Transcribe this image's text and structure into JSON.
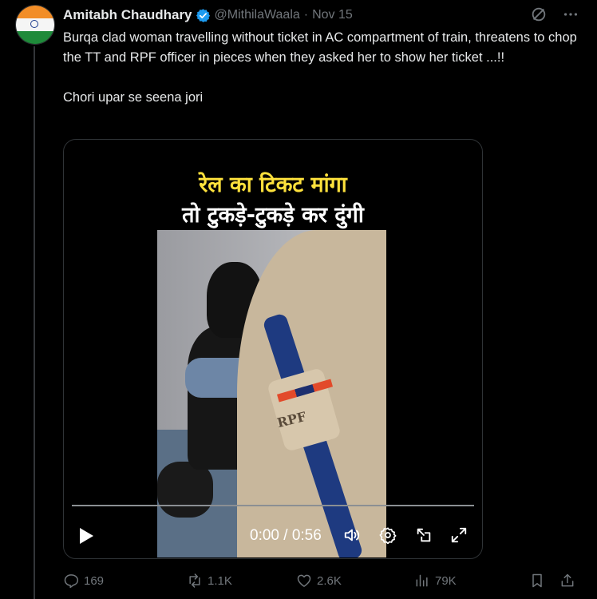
{
  "author": {
    "name": "Amitabh Chaudhary",
    "handle": "@MithilaWaala",
    "separator": "·",
    "date": "Nov 15"
  },
  "tweet": {
    "text": "Burqa clad woman travelling without ticket in AC compartment of train, threatens to chop the TT and RPF officer in pieces when they asked her to show her ticket ...!!\n\nChori upar se seena jori"
  },
  "video": {
    "caption_line1": "रेल का टिकट मांगा",
    "caption_line2": "तो टुकड़े-टुकड़े कर दुंगी",
    "badge_text": "RPF",
    "time_display": "0:00 / 0:56",
    "progress": 0.0
  },
  "actions": {
    "replies": "169",
    "reposts": "1.1K",
    "likes": "2.6K",
    "views": "79K"
  },
  "colors": {
    "background": "#000000",
    "text": "#e7e9ea",
    "muted": "#71767b",
    "verified": "#1d9bf0",
    "caption_yellow": "#fde13c"
  },
  "icons": [
    "grok-icon",
    "more-icon",
    "verified-icon",
    "play-icon",
    "volume-icon",
    "settings-icon",
    "pip-icon",
    "fullscreen-icon",
    "reply-icon",
    "repost-icon",
    "like-icon",
    "views-icon",
    "bookmark-icon",
    "share-icon"
  ]
}
